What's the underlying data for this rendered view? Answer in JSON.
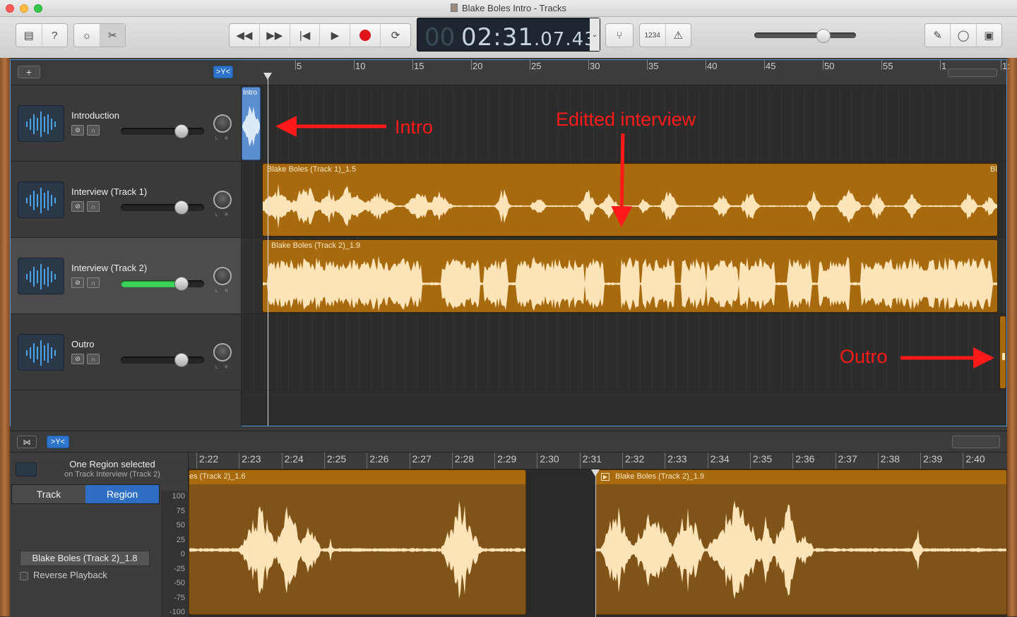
{
  "window": {
    "title": "Blake Boles Intro - Tracks"
  },
  "toolbar": {
    "lcd_bar": "00",
    "lcd_time": "02:31",
    "lcd_frac": ".07.43",
    "count_in_label": "1234"
  },
  "tracks": [
    {
      "name": "Introduction",
      "fader": 0.73,
      "region": "Intro"
    },
    {
      "name": "Interview (Track 1)",
      "fader": 0.73,
      "region": "Blake Boles (Track 1)_1.5",
      "region_tail": "Bl"
    },
    {
      "name": "Interview (Track 2)",
      "fader": 0.73,
      "region": "Blake Boles (Track 2)_1.9"
    },
    {
      "name": "Outro",
      "fader": 0.73,
      "region": ""
    }
  ],
  "ruler": {
    "labels": [
      "5",
      "10",
      "15",
      "20",
      "25",
      "30",
      "35",
      "40",
      "45",
      "50",
      "55",
      "1",
      "1:"
    ]
  },
  "annotations": {
    "intro": "Intro",
    "edited": "Editted interview",
    "outro": "Outro"
  },
  "editor": {
    "selection_title": "One Region selected",
    "selection_sub": "on Track Interview (Track 2)",
    "tab_track": "Track",
    "tab_region": "Region",
    "region_name": "Blake Boles (Track 2)_1.8",
    "reverse_label": "Reverse Playback",
    "time_labels": [
      "2:22",
      "2:23",
      "2:24",
      "2:25",
      "2:26",
      "2:27",
      "2:28",
      "2:29",
      "2:30",
      "2:31",
      "2:32",
      "2:33",
      "2:34",
      "2:35",
      "2:36",
      "2:37",
      "2:38",
      "2:39",
      "2:40"
    ],
    "y_labels": [
      "100",
      "75",
      "50",
      "25",
      "0",
      "-25",
      "-50",
      "-75",
      "-100"
    ],
    "left_region": "es (Track 2)_1.6",
    "right_region": "Blake Boles (Track 2)_1.9"
  },
  "colors": {
    "region_orange": "#a86a0f",
    "region_wave": "#fde3b8",
    "accent_blue": "#2e74c9",
    "annotation_red": "#ff1a1a"
  }
}
